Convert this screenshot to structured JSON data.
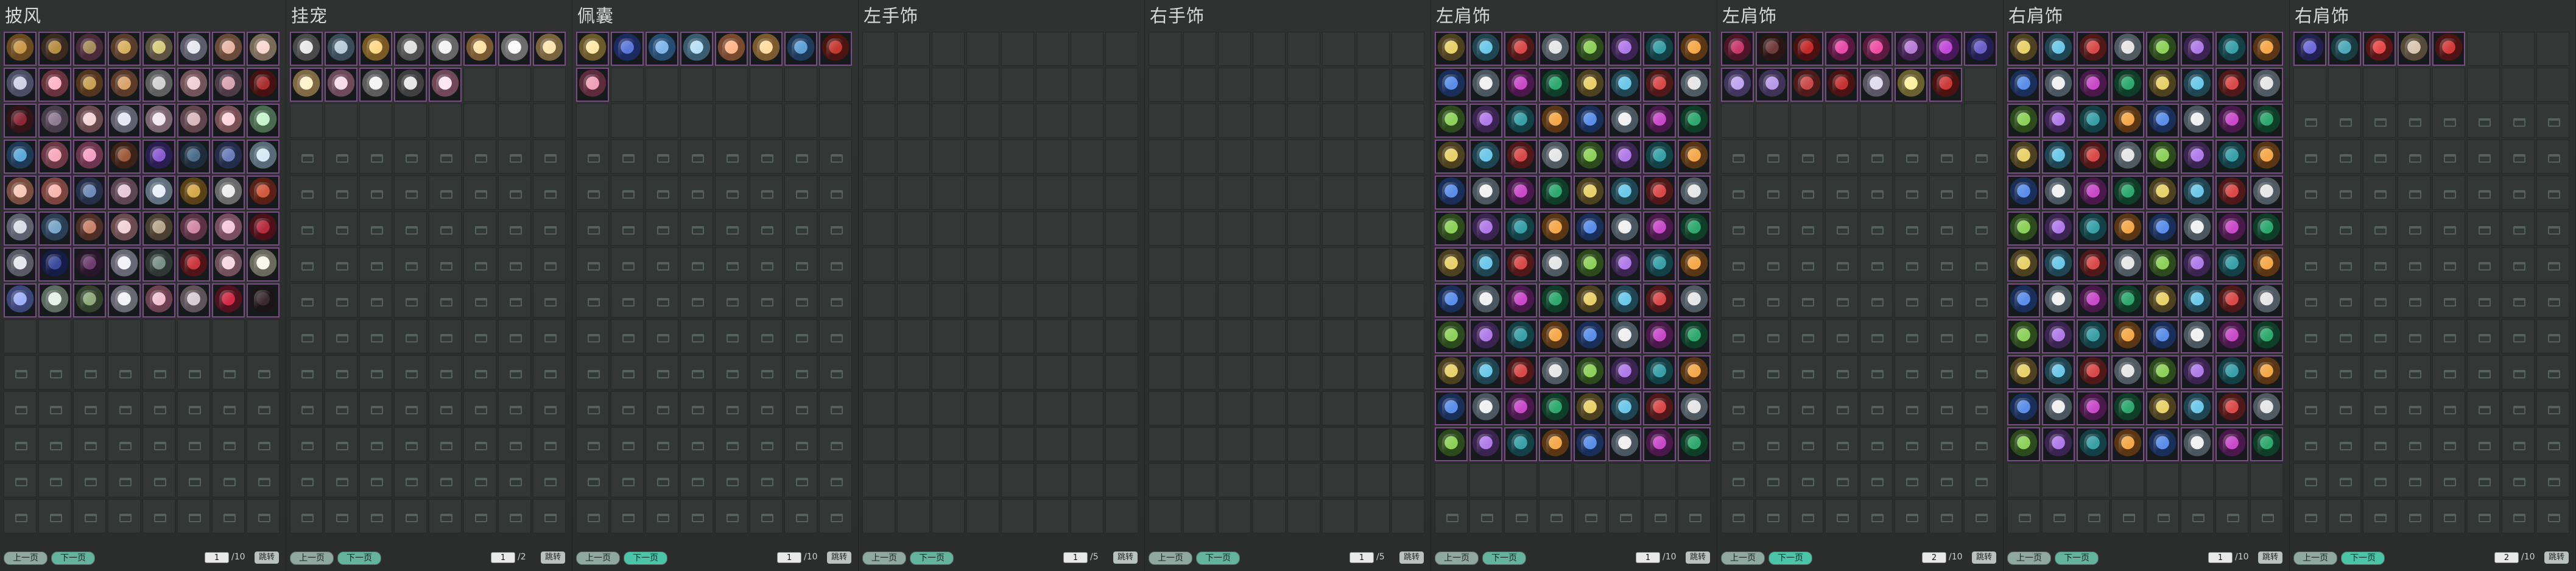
{
  "panels": [
    {
      "key": "cape",
      "title": "披风",
      "rows": 14,
      "items": [
        [
          "#c89a4a",
          "#6b4a22"
        ],
        [
          "#b58d42",
          "#3a2a1f"
        ],
        [
          "#a58b5b",
          "#4a2b3a"
        ],
        [
          "#d8b062",
          "#5a3c2a"
        ],
        [
          "#d7cc7e",
          "#5c5440"
        ],
        [
          "#e8e6ef",
          "#5d5c6c"
        ],
        [
          "#e6b6a5",
          "#6a4a3a"
        ],
        [
          "#f7d7d0",
          "#7a6a5a"
        ],
        [
          "#cfd1e8",
          "#4a4e66"
        ],
        [
          "#ffb6c6",
          "#68333d"
        ],
        [
          "#c8a056",
          "#54361e"
        ],
        [
          "#d9a46c",
          "#5b3a2a"
        ],
        [
          "#d2d2d2",
          "#5f5f5f"
        ],
        [
          "#f0cfd8",
          "#74545b"
        ],
        [
          "#d8a3b0",
          "#4d3b48"
        ],
        [
          "#a92f2f",
          "#461111"
        ],
        [
          "#8b2737",
          "#351419"
        ],
        [
          "#8f7a93",
          "#463c4a"
        ],
        [
          "#f3d6d5",
          "#6a4a4d"
        ],
        [
          "#e6e6f4",
          "#606070"
        ],
        [
          "#f2e8ef",
          "#7b6670"
        ],
        [
          "#d7b9be",
          "#60454c"
        ],
        [
          "#ffd5dd",
          "#7a5057"
        ],
        [
          "#c7f4cf",
          "#4a6a4f"
        ],
        [
          "#5da9d8",
          "#1f3a57"
        ],
        [
          "#f5a9b9",
          "#6d3947"
        ],
        [
          "#f3a0c2",
          "#6e3550"
        ],
        [
          "#9b5a3c",
          "#3d2218"
        ],
        [
          "#8b5bd0",
          "#2a1d52"
        ],
        [
          "#4b6c8a",
          "#1d2b3a"
        ],
        [
          "#6a7db8",
          "#242c4b"
        ],
        [
          "#d7eaf4",
          "#596b78"
        ],
        [
          "#f7c8b8",
          "#7a4d42"
        ],
        [
          "#f8b6ae",
          "#7c4540"
        ],
        [
          "#6f8bb8",
          "#27304a"
        ],
        [
          "#e6c8da",
          "#5d4555"
        ],
        [
          "#e9eff8",
          "#637080"
        ],
        [
          "#d4a84a",
          "#5a4216"
        ],
        [
          "#ececec",
          "#6a6a6a"
        ],
        [
          "#d05a3e",
          "#5a1f15"
        ],
        [
          "#d9dde7",
          "#5d6170"
        ],
        [
          "#7aa5c8",
          "#2a3e55"
        ],
        [
          "#c8826b",
          "#4e2e26"
        ],
        [
          "#f1d2d6",
          "#6c4b50"
        ],
        [
          "#b6a68d",
          "#4b3f31"
        ],
        [
          "#d18aa5",
          "#5b3244"
        ],
        [
          "#f5c8d9",
          "#7a4e5e"
        ],
        [
          "#b52a3d",
          "#4d0f18"
        ],
        [
          "#e6e6ee",
          "#595a66"
        ],
        [
          "#3a4a9a",
          "#151c45"
        ],
        [
          "#6c3d6e",
          "#2a162b"
        ],
        [
          "#f2f1f7",
          "#676775"
        ],
        [
          "#7a8f88",
          "#2f3835"
        ],
        [
          "#c9373c",
          "#501418"
        ],
        [
          "#f6d8e2",
          "#71505b"
        ],
        [
          "#f8f6ea",
          "#6c6a5d"
        ],
        [
          "#9fb0f5",
          "#3d4678"
        ],
        [
          "#e7f1ea",
          "#5c6c61"
        ],
        [
          "#8fa87c",
          "#34412c"
        ],
        [
          "#f2f2f6",
          "#686872"
        ],
        [
          "#f1c1d2",
          "#6e4151"
        ],
        [
          "#d8ccd4",
          "#5e5358"
        ],
        [
          "#d02a44",
          "#52111e"
        ],
        [
          "#3a2a30",
          "#1b1517"
        ]
      ]
    },
    {
      "key": "pet",
      "title": "挂宠",
      "rows": 14,
      "items": [
        [
          "#e8e8e8",
          "#4a4a4a"
        ],
        [
          "#b8cbd8",
          "#3b4d5a"
        ],
        [
          "#ffd88a",
          "#7a5a24"
        ],
        [
          "#e0e0e0",
          "#505050"
        ],
        [
          "#f4f4f4",
          "#666666"
        ],
        [
          "#ffe3a8",
          "#7a5a33"
        ],
        [
          "#fbfbfb",
          "#6c6c6c"
        ],
        [
          "#fde4b0",
          "#7a6440"
        ],
        [
          "#fff2cc",
          "#806a44"
        ],
        [
          "#f7dbe9",
          "#6e4b5c"
        ],
        [
          "#f3f3f3",
          "#5c5c5c"
        ],
        [
          "#e6e6e6",
          "#404040"
        ],
        [
          "#ffe6f0",
          "#704858"
        ]
      ]
    },
    {
      "key": "sachet",
      "title": "佩囊",
      "rows": 14,
      "items": [
        [
          "#ffe8a8",
          "#6d5a2c"
        ],
        [
          "#5a78d8",
          "#1c2a62"
        ],
        [
          "#7fb6e8",
          "#274c72"
        ],
        [
          "#b8dff5",
          "#3a5c70"
        ],
        [
          "#ffb68a",
          "#7a4a30"
        ],
        [
          "#ffdca0",
          "#7a5a2e"
        ],
        [
          "#5fa0d6",
          "#1e3b5c"
        ],
        [
          "#c4382e",
          "#4c1410"
        ],
        [
          "#f0a0b8",
          "#5e2b3c"
        ]
      ]
    },
    {
      "key": "left_hand",
      "title": "左手饰",
      "rows": 14,
      "items": []
    },
    {
      "key": "right_hand",
      "title": "右手饰",
      "rows": 14,
      "items": []
    },
    {
      "key": "left_shoulder",
      "title": "左肩饰",
      "rows": 14,
      "items": "many"
    },
    {
      "key": "left_shoulder2",
      "title": "左肩饰",
      "rows": 14,
      "items": [
        [
          "#c7386a",
          "#4e1428"
        ],
        [
          "#6f3b3b",
          "#2b1616"
        ],
        [
          "#c42a2a",
          "#4c1010"
        ],
        [
          "#e84aa8",
          "#5a1742"
        ],
        [
          "#ef4fa3",
          "#5c1a40"
        ],
        [
          "#b87dd8",
          "#40214e"
        ],
        [
          "#c24ad8",
          "#48185a"
        ],
        [
          "#6b5fc8",
          "#241e52"
        ],
        [
          "#bfa4f0",
          "#43365e"
        ],
        [
          "#b99ae8",
          "#3f3358"
        ],
        [
          "#c84a4a",
          "#4e1a1a"
        ],
        [
          "#c43232",
          "#4a1212"
        ],
        [
          "#e0dcf0",
          "#5a5666"
        ],
        [
          "#fff0a0",
          "#6a6030"
        ],
        [
          "#cc3a3a",
          "#4c1212"
        ]
      ]
    },
    {
      "key": "right_shoulder",
      "title": "右肩饰",
      "rows": 14,
      "items": "many"
    },
    {
      "key": "right_shoulder2",
      "title": "右肩饰",
      "rows": 14,
      "items": [
        [
          "#6f6ad8",
          "#232152"
        ],
        [
          "#4fa8b8",
          "#183c42"
        ],
        [
          "#e84848",
          "#5a1616"
        ],
        [
          "#d7c7b0",
          "#564a3a"
        ],
        [
          "#d43a3a",
          "#4e1414"
        ]
      ]
    }
  ],
  "pagers": [
    {
      "prev": "上一页",
      "next": "下一页",
      "page": "1",
      "total": "/10",
      "goto": "跳转",
      "next_active": false
    },
    {
      "prev": "上一页",
      "next": "下一页",
      "page": "1",
      "total": "/2",
      "goto": "跳转",
      "next_active": false
    },
    {
      "prev": "上一页",
      "next": "下一页",
      "page": "1",
      "total": "/10",
      "goto": "跳转",
      "next_active": true
    },
    {
      "prev": "上一页",
      "next": "下一页",
      "page": "1",
      "total": "/5",
      "goto": "跳转",
      "next_active": false
    },
    {
      "prev": "上一页",
      "next": "下一页",
      "page": "1",
      "total": "/5",
      "goto": "跳转",
      "next_active": false
    },
    {
      "prev": "上一页",
      "next": "下一页",
      "page": "1",
      "total": "/10",
      "goto": "跳转",
      "next_active": false
    },
    {
      "prev": "上一页",
      "next": "下一页",
      "page": "2",
      "total": "/10",
      "goto": "跳转",
      "next_active": true
    },
    {
      "prev": "上一页",
      "next": "下一页",
      "page": "1",
      "total": "/10",
      "goto": "跳转",
      "next_active": false
    },
    {
      "prev": "上一页",
      "next": "下一页",
      "page": "2",
      "total": "/10",
      "goto": "跳转",
      "next_active": true
    }
  ],
  "many_palette": [
    [
      "#e8d06a",
      "#4e4120"
    ],
    [
      "#6cc7e8",
      "#1f4552"
    ],
    [
      "#d84a4a",
      "#501818"
    ],
    [
      "#e6e6e6",
      "#505a62"
    ],
    [
      "#8dd05a",
      "#2c4a1c"
    ],
    [
      "#b07ae8",
      "#3c2452"
    ],
    [
      "#3aa0a8",
      "#124046"
    ],
    [
      "#f4a84a",
      "#5a3614"
    ],
    [
      "#5a8ee8",
      "#1a2e5a"
    ],
    [
      "#f0f0f0",
      "#4a5660"
    ],
    [
      "#c84ac8",
      "#4a184a"
    ],
    [
      "#2ea86e",
      "#0f3e28"
    ]
  ]
}
